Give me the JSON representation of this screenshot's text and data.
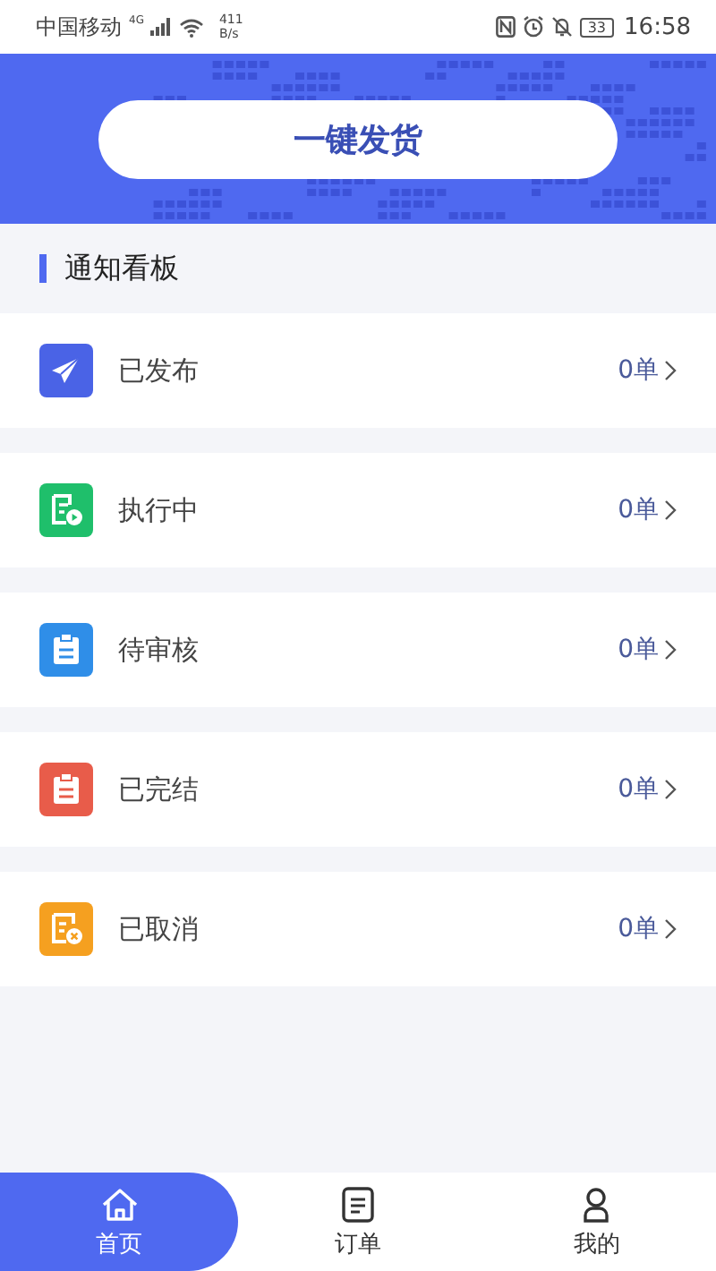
{
  "status_bar": {
    "carrier": "中国移动",
    "network": "4G",
    "speed": "411",
    "speed_unit": "B/s",
    "battery": "33",
    "time": "16:58"
  },
  "banner": {
    "button": "一键发货"
  },
  "section": {
    "title": "通知看板"
  },
  "rows": [
    {
      "kind": "send",
      "label": "已发布",
      "count": "0单",
      "color": "#4a63e6"
    },
    {
      "kind": "running",
      "label": "执行中",
      "count": "0单",
      "color": "#1fbf6b"
    },
    {
      "kind": "review",
      "label": "待审核",
      "count": "0单",
      "color": "#2f8ee8"
    },
    {
      "kind": "done",
      "label": "已完结",
      "count": "0单",
      "color": "#e85c4a"
    },
    {
      "kind": "cancel",
      "label": "已取消",
      "count": "0单",
      "color": "#f5a020"
    }
  ],
  "tabs": [
    {
      "kind": "home",
      "label": "首页",
      "selected": true
    },
    {
      "kind": "orders",
      "label": "订单",
      "selected": false
    },
    {
      "kind": "me",
      "label": "我的",
      "selected": false
    }
  ]
}
